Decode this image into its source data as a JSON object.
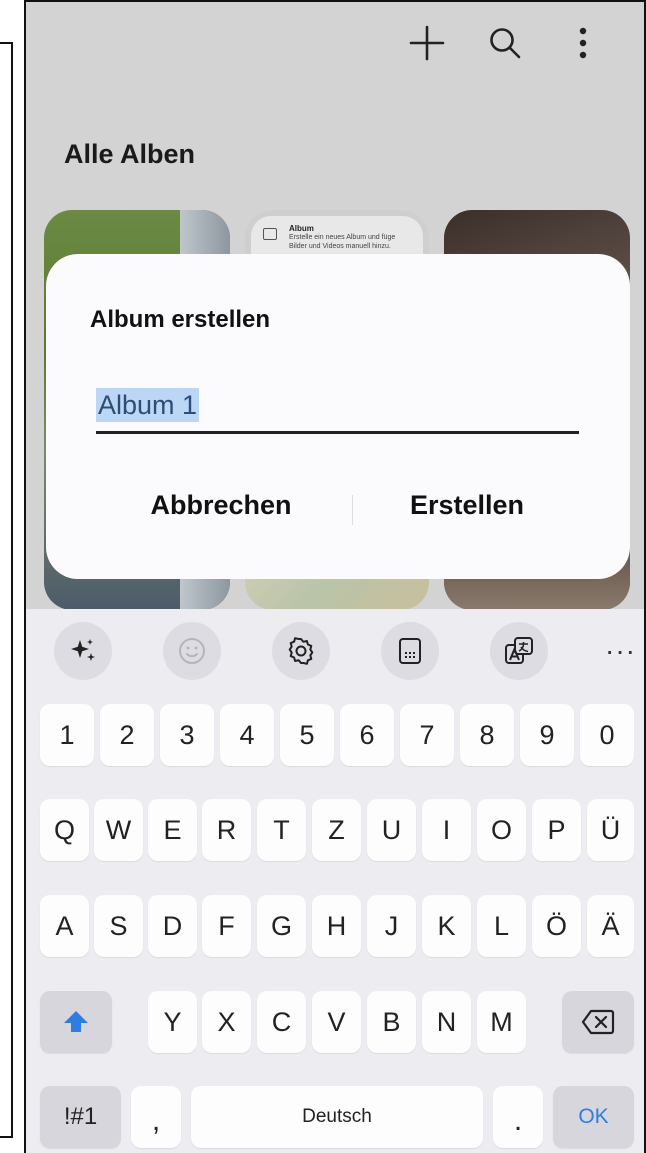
{
  "screen": {
    "title": "Alle Alben",
    "album_card": {
      "heading": "Album",
      "text": "Erstelle ein neues Album und füge Bilder und Videos manuell hinzu."
    }
  },
  "topbar": {
    "icons": [
      "plus-icon",
      "search-icon",
      "more-vert-icon"
    ]
  },
  "dialog": {
    "title": "Album erstellen",
    "input_value": "Album 1",
    "cancel_label": "Abbrechen",
    "create_label": "Erstellen"
  },
  "keyboard": {
    "toolbar_icons": [
      "sparkle-icon",
      "emoji-icon",
      "settings-icon",
      "keyboard-mode-icon",
      "translate-icon",
      "more-icon"
    ],
    "more_label": "···",
    "row_numbers": [
      "1",
      "2",
      "3",
      "4",
      "5",
      "6",
      "7",
      "8",
      "9",
      "0"
    ],
    "row1": [
      "Q",
      "W",
      "E",
      "R",
      "T",
      "Z",
      "U",
      "I",
      "O",
      "P",
      "Ü"
    ],
    "row2": [
      "A",
      "S",
      "D",
      "F",
      "G",
      "H",
      "J",
      "K",
      "L",
      "Ö",
      "Ä"
    ],
    "row3": [
      "Y",
      "X",
      "C",
      "V",
      "B",
      "N",
      "M"
    ],
    "symbols_label": "!#1",
    "comma_label": ",",
    "space_label": "Deutsch",
    "period_label": ".",
    "ok_label": "OK",
    "accent_color": "#2f7de1"
  }
}
